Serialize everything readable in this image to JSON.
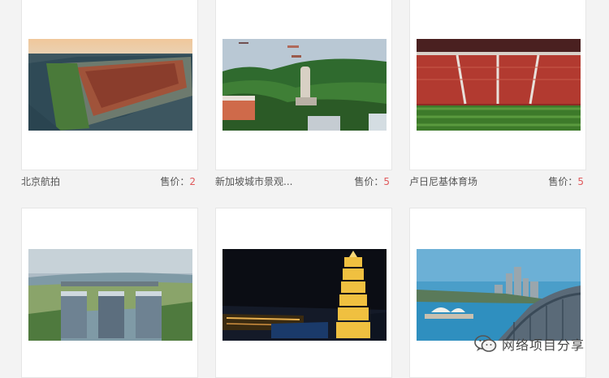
{
  "products": [
    {
      "title": "北京航拍",
      "price_label": "售价：",
      "price": "2",
      "image": "forbidden-city-aerial"
    },
    {
      "title": "新加坡城市景观...",
      "price_label": "售价：",
      "price": "5",
      "image": "merlion-island-aerial"
    },
    {
      "title": "卢日尼基体育场",
      "price_label": "售价：",
      "price": "5",
      "image": "stadium-aerial"
    },
    {
      "title": "",
      "price_label": "",
      "price": "",
      "image": "marina-bay-aerial"
    },
    {
      "title": "",
      "price_label": "",
      "price": "",
      "image": "pagoda-night"
    },
    {
      "title": "",
      "price_label": "",
      "price": "",
      "image": "sydney-harbour"
    }
  ],
  "watermark": {
    "text": "网络项目分享",
    "icon": "wechat-icon"
  },
  "colors": {
    "price": "#e0595b",
    "text": "#555555",
    "background": "#f3f3f3"
  }
}
